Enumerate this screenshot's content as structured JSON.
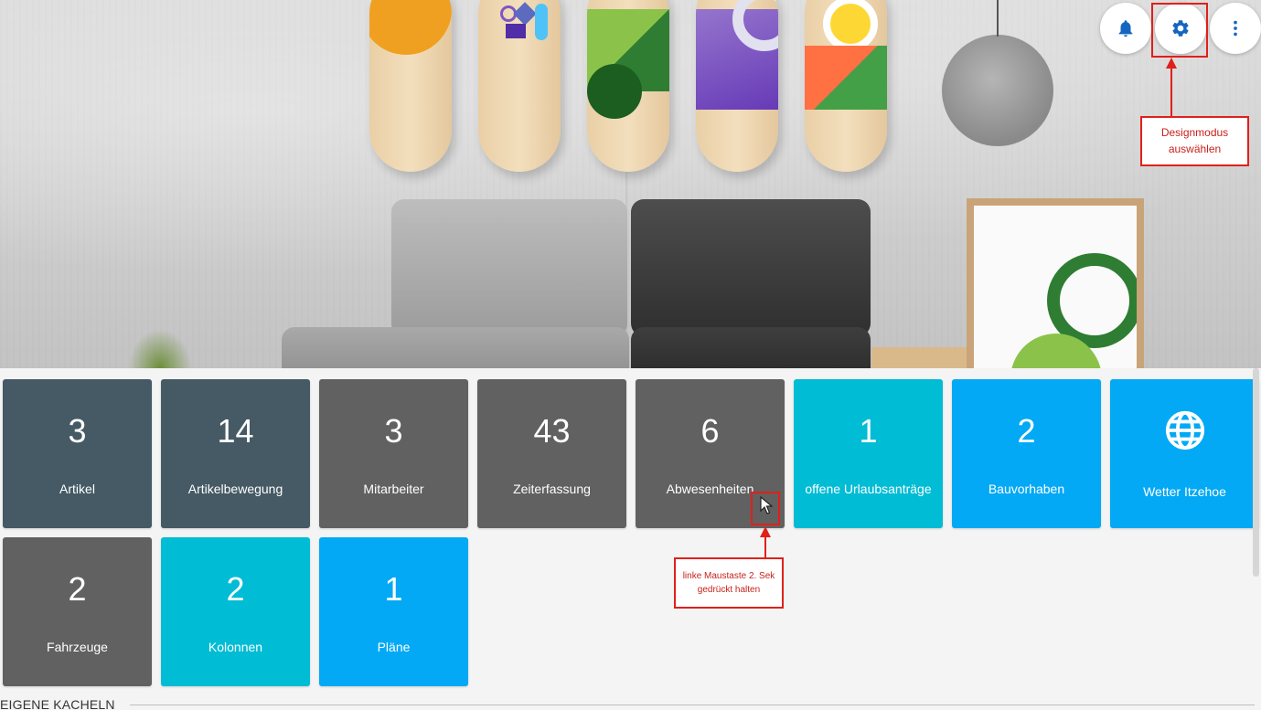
{
  "header": {
    "buttons": [
      {
        "name": "notifications-button",
        "icon": "bell-icon"
      },
      {
        "name": "settings-button",
        "icon": "gear-icon"
      },
      {
        "name": "more-button",
        "icon": "more-vertical-icon"
      }
    ]
  },
  "annotations": {
    "settings": "Designmodus auswählen",
    "settings_lines": [
      "Designmodus",
      "auswählen"
    ],
    "tile_hold_lines": [
      "linke Maustaste 2. Sek",
      "gedrückt halten"
    ],
    "color": "#e0201a"
  },
  "tiles": [
    {
      "count": "3",
      "label": "Artikel",
      "color": "#455a64"
    },
    {
      "count": "14",
      "label": "Artikelbewegung",
      "color": "#455a64"
    },
    {
      "count": "3",
      "label": "Mitarbeiter",
      "color": "#616161"
    },
    {
      "count": "43",
      "label": "Zeiterfassung",
      "color": "#616161"
    },
    {
      "count": "6",
      "label": "Abwesenheiten",
      "color": "#616161"
    },
    {
      "count": "1",
      "label": "offene Urlaubsanträge",
      "color": "#00bcd4"
    },
    {
      "count": "2",
      "label": "Bauvorhaben",
      "color": "#03a9f4"
    },
    {
      "icon": "globe-icon",
      "label": "Wetter Itzehoe",
      "color": "#03a9f4"
    },
    {
      "count": "2",
      "label": "Fahrzeuge",
      "color": "#616161"
    },
    {
      "count": "2",
      "label": "Kolonnen",
      "color": "#00bcd4"
    },
    {
      "count": "1",
      "label": "Pläne",
      "color": "#03a9f4"
    }
  ],
  "section": {
    "title": "EIGENE KACHELN"
  },
  "colors": {
    "accent": "#1565c0",
    "slate": "#455a64",
    "gray": "#616161",
    "cyan": "#00bcd4",
    "blue": "#03a9f4"
  }
}
